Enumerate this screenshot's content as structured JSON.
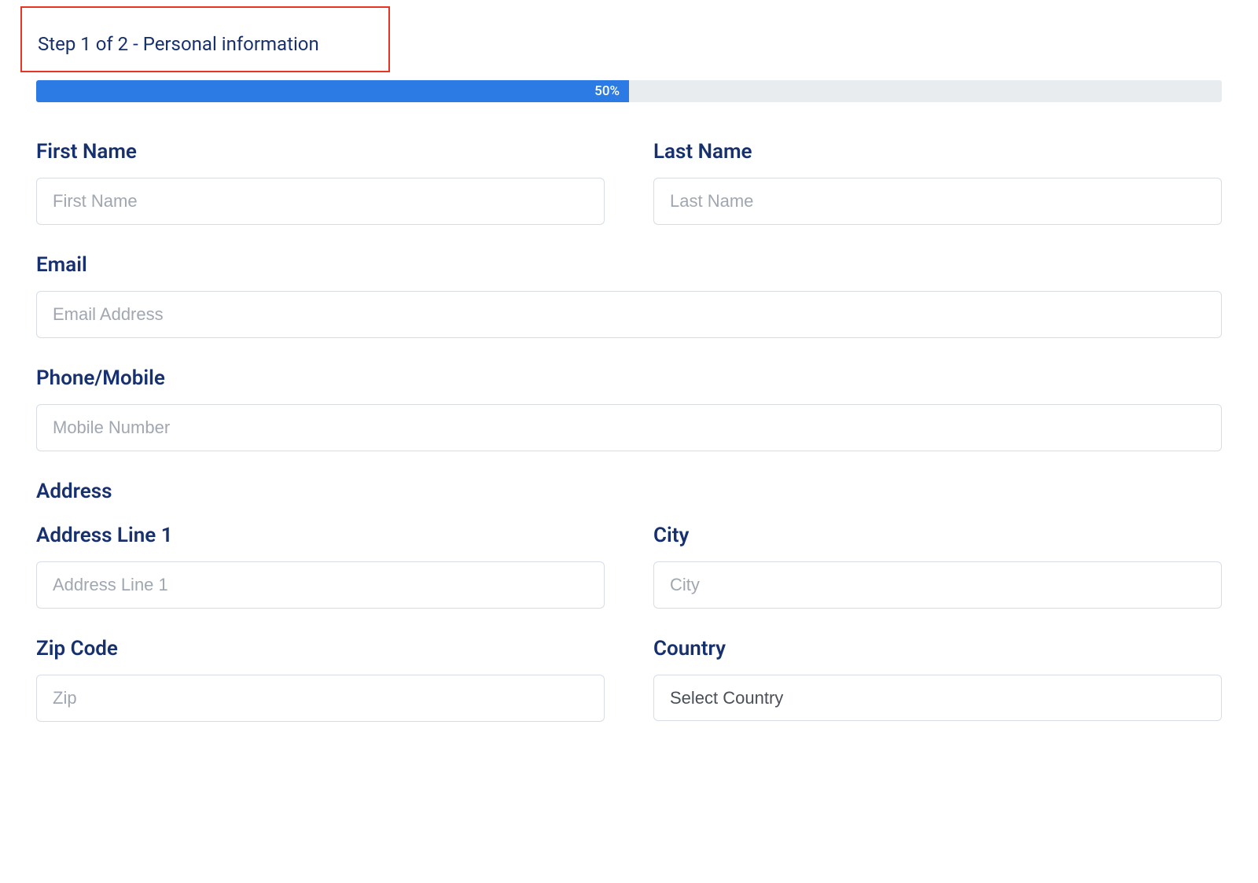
{
  "step": {
    "text": "Step 1 of 2 - Personal information"
  },
  "progress": {
    "percent": "50%",
    "width": "50%"
  },
  "fields": {
    "firstName": {
      "label": "First Name",
      "placeholder": "First Name",
      "value": ""
    },
    "lastName": {
      "label": "Last Name",
      "placeholder": "Last Name",
      "value": ""
    },
    "email": {
      "label": "Email",
      "placeholder": "Email Address",
      "value": ""
    },
    "phone": {
      "label": "Phone/Mobile",
      "placeholder": "Mobile Number",
      "value": ""
    },
    "addressSection": {
      "label": "Address"
    },
    "addressLine1": {
      "label": "Address Line 1",
      "placeholder": "Address Line 1",
      "value": ""
    },
    "city": {
      "label": "City",
      "placeholder": "City",
      "value": ""
    },
    "zipCode": {
      "label": "Zip Code",
      "placeholder": "Zip",
      "value": ""
    },
    "country": {
      "label": "Country",
      "placeholder": "Select Country",
      "value": ""
    }
  }
}
